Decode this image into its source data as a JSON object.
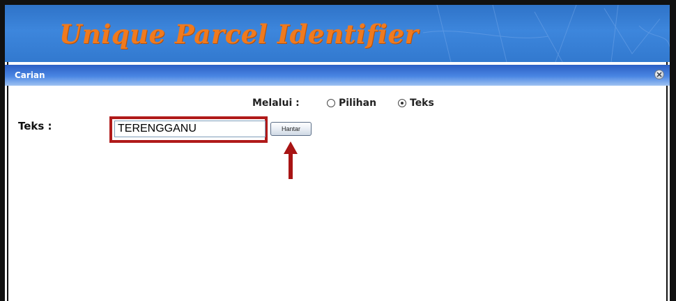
{
  "banner": {
    "title": "Unique Parcel Identifier"
  },
  "panel": {
    "title": "Carian",
    "close_icon": "close-circle-icon"
  },
  "search_mode": {
    "label": "Melalui :",
    "options": [
      {
        "label": "Pilihan",
        "selected": false
      },
      {
        "label": "Teks",
        "selected": true
      }
    ]
  },
  "form": {
    "text_label": "Teks :",
    "text_value": "TERENGGANU",
    "submit_label": "Hantar"
  },
  "annotation": {
    "arrow_icon": "up-arrow-icon",
    "highlight_color": "#b01a1a"
  },
  "colors": {
    "banner_bg": "#3d86dc",
    "title_orange": "#f07a1e",
    "header_blue": "#2b5fc4"
  }
}
